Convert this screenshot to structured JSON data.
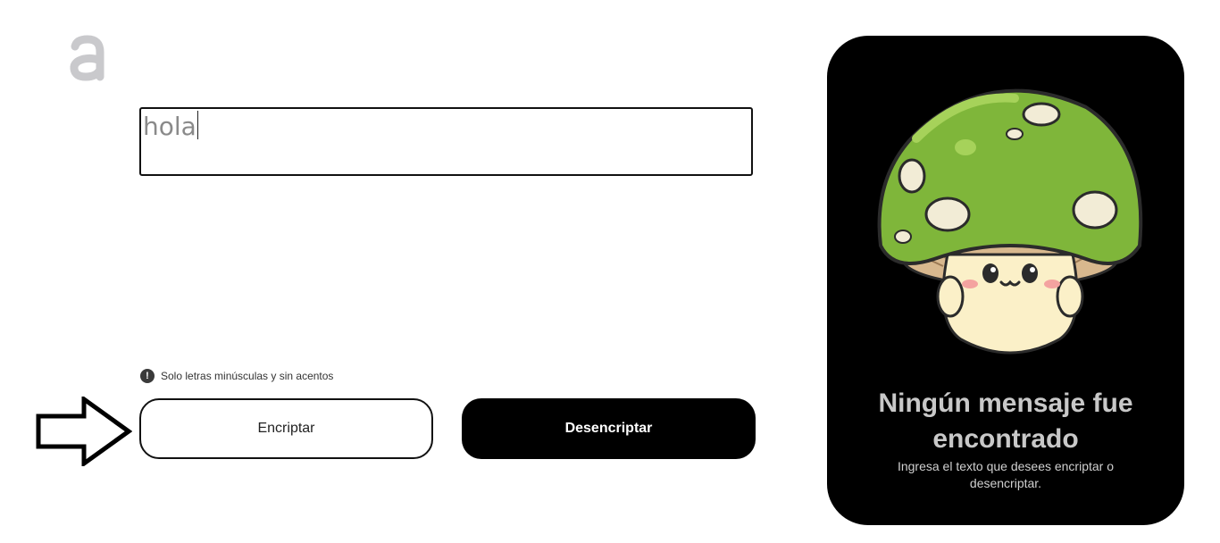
{
  "input": {
    "value": "hola"
  },
  "hint": {
    "icon_glyph": "!",
    "text": "Solo letras minúsculas y sin acentos"
  },
  "buttons": {
    "encrypt_label": "Encriptar",
    "decrypt_label": "Desencriptar"
  },
  "output_panel": {
    "title": "Ningún mensaje fue encontrado",
    "subtitle": "Ingresa el texto que desees encriptar o desencriptar.",
    "image": "mushroom-mascot"
  },
  "icons": {
    "logo": "alura-logo-icon",
    "pointer": "right-arrow-icon",
    "info": "exclamation-icon"
  },
  "colors": {
    "primary_dark": "#000000",
    "panel_text": "#c8c8c8",
    "mushroom_cap": "#7fb63a",
    "mushroom_body": "#fbf0c8"
  }
}
